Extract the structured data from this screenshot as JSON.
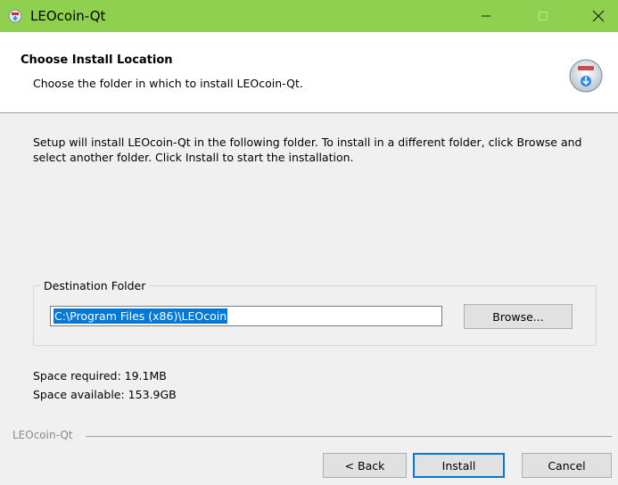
{
  "window": {
    "title": "LEOcoin-Qt",
    "title_bar_color": "#8fd14f",
    "controls": [
      "minimize-icon",
      "maximize-icon",
      "close-icon"
    ]
  },
  "header": {
    "title": "Choose Install Location",
    "subtitle": "Choose the folder in which to install LEOcoin-Qt.",
    "icon": "installer-icon"
  },
  "body": {
    "description": "Setup will install LEOcoin-Qt in the following folder. To install in a different folder, click Browse and select another folder. Click Install to start the installation.",
    "destination": {
      "legend": "Destination Folder",
      "path": "C:\\Program Files (x86)\\LEOcoin",
      "browse_label": "Browse..."
    },
    "space_required": "Space required: 19.1MB",
    "space_available": "Space available: 153.9GB"
  },
  "footer": {
    "branding": "LEOcoin-Qt",
    "back_label": "< Back",
    "install_label": "Install",
    "cancel_label": "Cancel"
  },
  "colors": {
    "accent": "#0078d7",
    "selection": "#0078d7"
  }
}
